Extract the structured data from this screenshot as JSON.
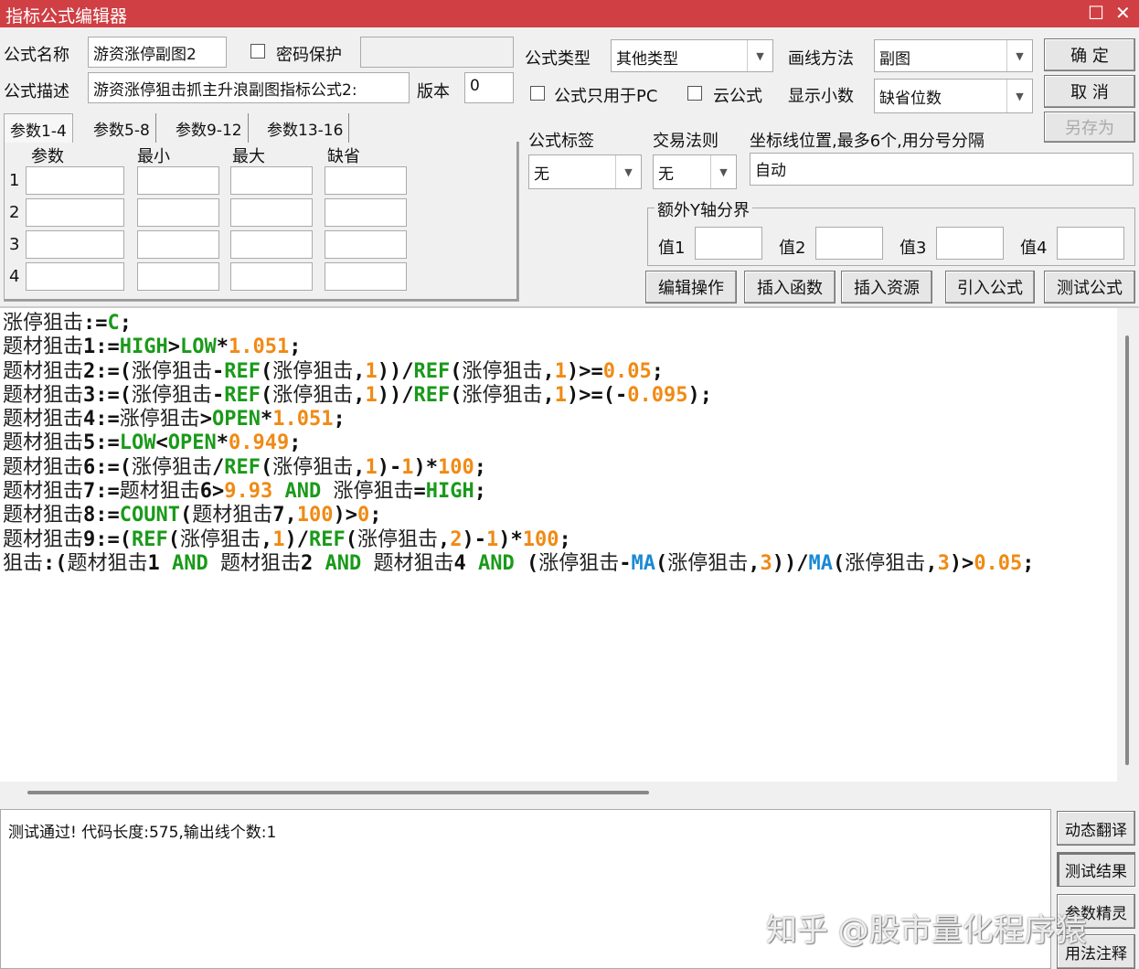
{
  "window": {
    "title": "指标公式编辑器",
    "maximize": "☐",
    "close": "✕"
  },
  "form": {
    "name_label": "公式名称",
    "name_value": "游资涨停副图2",
    "password_label": "密码保护",
    "password_value": "",
    "desc_label": "公式描述",
    "desc_value": "游资涨停狙击抓主升浪副图指标公式2:",
    "version_label": "版本",
    "version_value": "0",
    "type_label": "公式类型",
    "type_value": "其他类型",
    "draw_label": "画线方法",
    "draw_value": "副图",
    "pc_only_label": "公式只用于PC",
    "cloud_label": "云公式",
    "decimals_label": "显示小数",
    "decimals_value": "缺省位数",
    "tag_label": "公式标签",
    "tag_value": "无",
    "rule_label": "交易法则",
    "rule_value": "无",
    "axis_label": "坐标线位置,最多6个,用分号分隔",
    "axis_value": "自动",
    "extra_y_label": "额外Y轴分界",
    "y1": "值1",
    "y2": "值2",
    "y3": "值3",
    "y4": "值4"
  },
  "buttons": {
    "ok": "确  定",
    "cancel": "取  消",
    "save_as": "另存为",
    "edit_ops": "编辑操作",
    "insert_func": "插入函数",
    "insert_res": "插入资源",
    "import": "引入公式",
    "test": "测试公式",
    "dyn": "动态翻译",
    "result": "测试结果",
    "wizard": "参数精灵",
    "usage": "用法注释"
  },
  "tabs": [
    "参数1-4",
    "参数5-8",
    "参数9-12",
    "参数13-16"
  ],
  "params": {
    "headers": [
      "参数",
      "最小",
      "最大",
      "缺省"
    ],
    "rows": [
      "1",
      "2",
      "3",
      "4"
    ]
  },
  "code": [
    [
      [
        "涨停狙击",
        "t"
      ],
      [
        ":=",
        "p"
      ],
      [
        "C",
        "k"
      ],
      [
        ";",
        "p"
      ]
    ],
    [
      [
        "题材狙击",
        "t"
      ],
      [
        "1:=",
        "p"
      ],
      [
        "HIGH",
        "k"
      ],
      [
        ">",
        "p"
      ],
      [
        "LOW",
        "k"
      ],
      [
        "*",
        "p"
      ],
      [
        "1.",
        "n"
      ],
      [
        "051",
        "n"
      ],
      [
        ";",
        "p"
      ]
    ],
    [
      [
        "题材狙击",
        "t"
      ],
      [
        "2:=(",
        "p"
      ],
      [
        "涨停狙击",
        "t"
      ],
      [
        "-",
        "p"
      ],
      [
        "REF",
        "k"
      ],
      [
        "(",
        "p"
      ],
      [
        "涨停狙击",
        "t"
      ],
      [
        ",",
        "p"
      ],
      [
        "1",
        "n"
      ],
      [
        "))/",
        "p"
      ],
      [
        "REF",
        "k"
      ],
      [
        "(",
        "p"
      ],
      [
        "涨停狙击",
        "t"
      ],
      [
        ",",
        "p"
      ],
      [
        "1",
        "n"
      ],
      [
        ")>=",
        "p"
      ],
      [
        "0.05",
        "n"
      ],
      [
        ";",
        "p"
      ]
    ],
    [
      [
        "题材狙击",
        "t"
      ],
      [
        "3:=(",
        "p"
      ],
      [
        "涨停狙击",
        "t"
      ],
      [
        "-",
        "p"
      ],
      [
        "REF",
        "k"
      ],
      [
        "(",
        "p"
      ],
      [
        "涨停狙击",
        "t"
      ],
      [
        ",",
        "p"
      ],
      [
        "1",
        "n"
      ],
      [
        "))/",
        "p"
      ],
      [
        "REF",
        "k"
      ],
      [
        "(",
        "p"
      ],
      [
        "涨停狙击",
        "t"
      ],
      [
        ",",
        "p"
      ],
      [
        "1",
        "n"
      ],
      [
        ")>=(-",
        "p"
      ],
      [
        "0.095",
        "n"
      ],
      [
        ");",
        "p"
      ]
    ],
    [
      [
        "题材狙击",
        "t"
      ],
      [
        "4:=",
        "p"
      ],
      [
        "涨停狙击",
        "t"
      ],
      [
        ">",
        "p"
      ],
      [
        "OPEN",
        "k"
      ],
      [
        "*",
        "p"
      ],
      [
        "1.051",
        "n"
      ],
      [
        ";",
        "p"
      ]
    ],
    [
      [
        "题材狙击",
        "t"
      ],
      [
        "5:=",
        "p"
      ],
      [
        "LOW",
        "k"
      ],
      [
        "<",
        "p"
      ],
      [
        "OPEN",
        "k"
      ],
      [
        "*",
        "p"
      ],
      [
        "0.949",
        "n"
      ],
      [
        ";",
        "p"
      ]
    ],
    [
      [
        "题材狙击",
        "t"
      ],
      [
        "6:=(",
        "p"
      ],
      [
        "涨停狙击",
        "t"
      ],
      [
        "/",
        "p"
      ],
      [
        "REF",
        "k"
      ],
      [
        "(",
        "p"
      ],
      [
        "涨停狙击",
        "t"
      ],
      [
        ",",
        "p"
      ],
      [
        "1",
        "n"
      ],
      [
        ")-",
        "p"
      ],
      [
        "1",
        "n"
      ],
      [
        ")*",
        "p"
      ],
      [
        "100",
        "n"
      ],
      [
        ";",
        "p"
      ]
    ],
    [
      [
        "题材狙击",
        "t"
      ],
      [
        "7:=",
        "p"
      ],
      [
        "题材狙击",
        "t"
      ],
      [
        "6>",
        "p"
      ],
      [
        "9.93",
        "n"
      ],
      [
        " AND ",
        "k"
      ],
      [
        "涨停狙击",
        "t"
      ],
      [
        "=",
        "p"
      ],
      [
        "HIGH",
        "k"
      ],
      [
        ";",
        "p"
      ]
    ],
    [
      [
        "题材狙击",
        "t"
      ],
      [
        "8:=",
        "p"
      ],
      [
        "COUNT",
        "k"
      ],
      [
        "(",
        "p"
      ],
      [
        "题材狙击",
        "t"
      ],
      [
        "7,",
        "p"
      ],
      [
        "100",
        "n"
      ],
      [
        ")>",
        "p"
      ],
      [
        "0",
        "n"
      ],
      [
        ";",
        "p"
      ]
    ],
    [
      [
        "题材狙击",
        "t"
      ],
      [
        "9:=(",
        "p"
      ],
      [
        "REF",
        "k"
      ],
      [
        "(",
        "p"
      ],
      [
        "涨停狙击",
        "t"
      ],
      [
        ",",
        "p"
      ],
      [
        "1",
        "n"
      ],
      [
        ")/",
        "p"
      ],
      [
        "REF",
        "k"
      ],
      [
        "(",
        "p"
      ],
      [
        "涨停狙击",
        "t"
      ],
      [
        ",",
        "p"
      ],
      [
        "2",
        "n"
      ],
      [
        ")-",
        "p"
      ],
      [
        "1",
        "n"
      ],
      [
        ")*",
        "p"
      ],
      [
        "100",
        "n"
      ],
      [
        ";",
        "p"
      ]
    ],
    [
      [
        "狙击",
        "t"
      ],
      [
        ":(",
        "p"
      ],
      [
        "题材狙击",
        "t"
      ],
      [
        "1",
        "p"
      ],
      [
        " AND ",
        "k"
      ],
      [
        "题材狙击",
        "t"
      ],
      [
        "2",
        "p"
      ],
      [
        " AND ",
        "k"
      ],
      [
        "题材狙击",
        "t"
      ],
      [
        "4",
        "p"
      ],
      [
        " AND ",
        "k"
      ],
      [
        "(",
        "p"
      ],
      [
        "涨停狙击",
        "t"
      ],
      [
        "-",
        "p"
      ],
      [
        "MA",
        "b"
      ],
      [
        "(",
        "p"
      ],
      [
        "涨停狙击",
        "t"
      ],
      [
        ",",
        "p"
      ],
      [
        "3",
        "n"
      ],
      [
        "))/",
        "p"
      ],
      [
        "MA",
        "b"
      ],
      [
        "(",
        "p"
      ],
      [
        "涨停狙击",
        "t"
      ],
      [
        ",",
        "p"
      ],
      [
        "3",
        "n"
      ],
      [
        ")>",
        "p"
      ],
      [
        "0.05",
        "n"
      ],
      [
        ";",
        "p"
      ]
    ]
  ],
  "status": "测试通过! 代码长度:575,输出线个数:1",
  "watermark": "知乎 @股市量化程序猿",
  "colors": {
    "title": "#cf3f44",
    "keyword": "#1a9a1a",
    "number": "#f08a14",
    "ma": "#1a8ad4"
  }
}
